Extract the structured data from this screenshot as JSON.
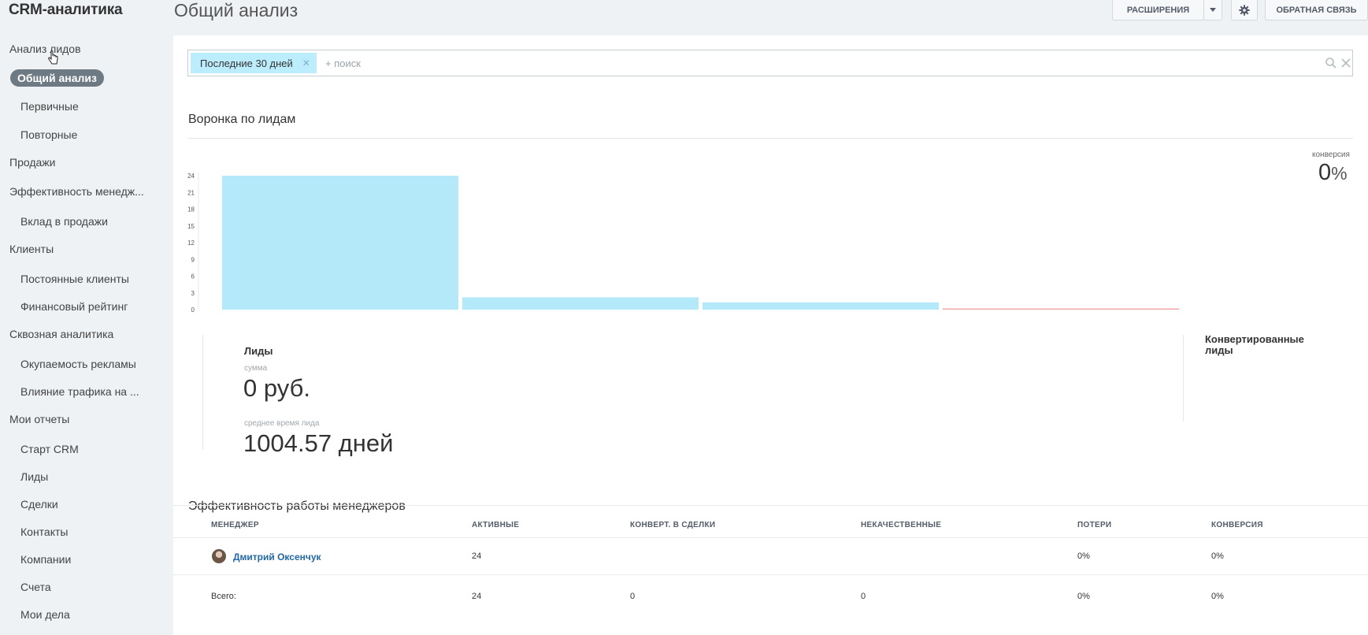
{
  "app": {
    "title": "CRM-аналитика"
  },
  "header": {
    "page_title": "Общий анализ",
    "extensions_label": "РАСШИРЕНИЯ",
    "feedback_label": "ОБРАТНАЯ СВЯЗЬ"
  },
  "sidebar": {
    "items": [
      {
        "label": "Анализ лидов",
        "level": "top"
      },
      {
        "label": "Общий анализ",
        "level": "active"
      },
      {
        "label": "Первичные",
        "level": "sub"
      },
      {
        "label": "Повторные",
        "level": "sub"
      },
      {
        "label": "Продажи",
        "level": "top"
      },
      {
        "label": "Эффективность менедж...",
        "level": "top"
      },
      {
        "label": "Вклад в продажи",
        "level": "sub"
      },
      {
        "label": "Клиенты",
        "level": "top"
      },
      {
        "label": "Постоянные клиенты",
        "level": "sub"
      },
      {
        "label": "Финансовый рейтинг",
        "level": "sub"
      },
      {
        "label": "Сквозная аналитика",
        "level": "top"
      },
      {
        "label": "Окупаемость рекламы",
        "level": "sub"
      },
      {
        "label": "Влияние трафика на ...",
        "level": "sub"
      },
      {
        "label": "Мои отчеты",
        "level": "top"
      },
      {
        "label": "Старт CRM",
        "level": "sub"
      },
      {
        "label": "Лиды",
        "level": "sub"
      },
      {
        "label": "Сделки",
        "level": "sub"
      },
      {
        "label": "Контакты",
        "level": "sub"
      },
      {
        "label": "Компании",
        "level": "sub"
      },
      {
        "label": "Счета",
        "level": "sub"
      },
      {
        "label": "Мои дела",
        "level": "sub"
      }
    ]
  },
  "filter": {
    "chip_label": "Последние 30 дней",
    "search_placeholder": "+ поиск"
  },
  "funnel": {
    "title": "Воронка по лидам",
    "conversion_label": "конверсия",
    "conversion_value": "0",
    "conversion_unit": "%",
    "leads_label": "Лиды",
    "sum_label": "сумма",
    "sum_value": "0 руб.",
    "avg_time_label": "среднее время лида",
    "avg_time_value": "1004.57 дней",
    "converted_label": "Конвертированные лиды"
  },
  "chart_data": {
    "type": "bar",
    "title": "",
    "xlabel": "",
    "ylabel": "",
    "ylim": [
      0,
      24
    ],
    "yticks": [
      0,
      3,
      6,
      9,
      12,
      15,
      18,
      21,
      24
    ],
    "values": [
      24,
      2.2,
      1.3,
      0.2
    ],
    "colors": [
      "#b3e9f8",
      "#b3e9f8",
      "#b3e9f8",
      "#f4a7ab"
    ]
  },
  "managers": {
    "title": "Эффективность работы менеджеров",
    "columns": [
      "МЕНЕДЖЕР",
      "АКТИВНЫЕ",
      "КОНВЕРТ. В СДЕЛКИ",
      "НЕКАЧЕСТВЕННЫЕ",
      "ПОТЕРИ",
      "КОНВЕРСИЯ"
    ],
    "row": {
      "name": "Дмитрий Оксенчук",
      "active": "24",
      "converted": "",
      "poor": "",
      "losses": "0%",
      "conversion": "0%"
    },
    "total": {
      "label": "Всего:",
      "active": "24",
      "converted": "0",
      "poor": "0",
      "losses": "0%",
      "conversion": "0%"
    }
  },
  "icons": {
    "settings": "gear-icon",
    "dropdown": "chevron-down-icon",
    "search": "search-icon",
    "clear": "close-icon",
    "avatar": "avatar",
    "cursor": "hand-cursor-icon"
  },
  "colors": {
    "accent_bar": "#b3e9f8",
    "loss_bar": "#f4a7ab",
    "active_nav": "#6e7a83",
    "link": "#2067b0"
  }
}
